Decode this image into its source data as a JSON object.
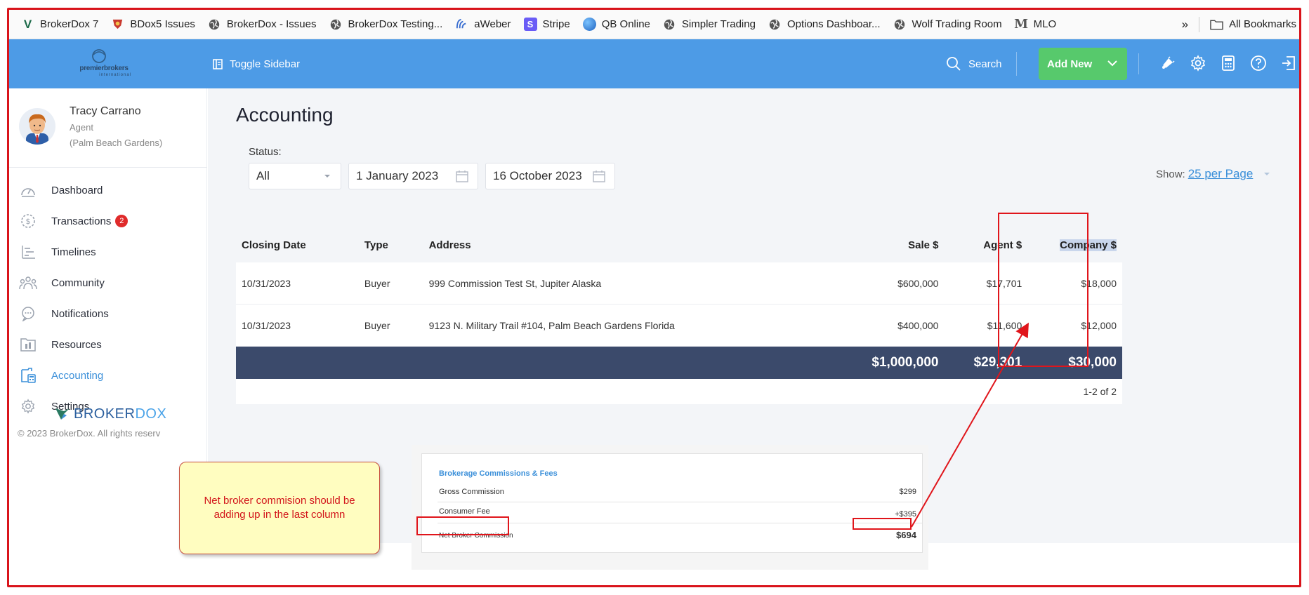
{
  "bookmarks": [
    {
      "label": "BrokerDox 7",
      "icon": "brokerdox-v-icon",
      "color": "#1d6b4a"
    },
    {
      "label": "BDox5 Issues",
      "icon": "bdox5-icon",
      "color": "#c9392e"
    },
    {
      "label": "BrokerDox - Issues",
      "icon": "globe-icon",
      "color": "#555555"
    },
    {
      "label": "BrokerDox Testing...",
      "icon": "globe-icon",
      "color": "#555555"
    },
    {
      "label": "aWeber",
      "icon": "aweber-icon",
      "color": "#3b6fd1"
    },
    {
      "label": "Stripe",
      "icon": "stripe-icon",
      "color": "#6a5cf6"
    },
    {
      "label": "QB Online",
      "icon": "qb-icon",
      "color": "#1e82e0"
    },
    {
      "label": "Simpler Trading",
      "icon": "globe-icon",
      "color": "#555555"
    },
    {
      "label": "Options Dashboar...",
      "icon": "globe-icon",
      "color": "#555555"
    },
    {
      "label": "Wolf Trading Room",
      "icon": "globe-icon",
      "color": "#555555"
    },
    {
      "label": "MLO",
      "icon": "mlo-m-icon",
      "color": "#555555"
    }
  ],
  "bookmarks_more": "»",
  "all_bookmarks": "All Bookmarks",
  "header": {
    "logo_text": "premierbrokers",
    "logo_sub": "international",
    "toggle_sidebar": "Toggle Sidebar",
    "search": "Search",
    "add_new": "Add New",
    "accent": "#4d9be6",
    "add_new_color": "#57c96c"
  },
  "profile": {
    "name": "Tracy Carrano",
    "role": "Agent",
    "location": "(Palm Beach Gardens)"
  },
  "nav": [
    {
      "label": "Dashboard",
      "icon": "dashboard-gauge-icon"
    },
    {
      "label": "Transactions",
      "icon": "dollar-circle-icon",
      "badge": "2"
    },
    {
      "label": "Timelines",
      "icon": "timeline-icon"
    },
    {
      "label": "Community",
      "icon": "community-icon"
    },
    {
      "label": "Notifications",
      "icon": "chat-bubble-icon"
    },
    {
      "label": "Resources",
      "icon": "folder-icon"
    },
    {
      "label": "Accounting",
      "icon": "accounting-icon",
      "active": true
    },
    {
      "label": "Settings",
      "icon": "gear-icon"
    }
  ],
  "sidebar_footer": {
    "brand_a": "BROKER",
    "brand_b": "DOX",
    "copyright": "© 2023 BrokerDox. All rights reserv"
  },
  "page": {
    "title": "Accounting",
    "status_label": "Status:",
    "status_value": "All",
    "date_from": "1 January 2023",
    "date_to": "16 October 2023",
    "show_label": "Show:",
    "per_page": "25 per Page"
  },
  "table": {
    "columns": [
      "Closing Date",
      "Type",
      "Address",
      "Sale $",
      "Agent $",
      "Company $"
    ],
    "rows": [
      [
        "10/31/2023",
        "Buyer",
        "999 Commission Test St, Jupiter Alaska",
        "$600,000",
        "$17,701",
        "$18,000"
      ],
      [
        "10/31/2023",
        "Buyer",
        "9123 N. Military Trail #104, Palm Beach Gardens Florida",
        "$400,000",
        "$11,600",
        "$12,000"
      ]
    ],
    "totals": [
      "$1,000,000",
      "$29,301",
      "$30,000"
    ],
    "pagination": "1-2 of 2",
    "totals_bg": "#3b4a6b"
  },
  "annotation": {
    "note": "Net broker commision should be adding up in the last column",
    "inset_title": "Brokerage Commissions & Fees",
    "inset_rows": [
      {
        "label": "Gross Commission",
        "value": "$299"
      },
      {
        "label": "Consumer Fee",
        "value": "+$395"
      },
      {
        "label": "Net Broker Commission",
        "value": "$694"
      }
    ],
    "highlight_color": "#e0151b"
  }
}
